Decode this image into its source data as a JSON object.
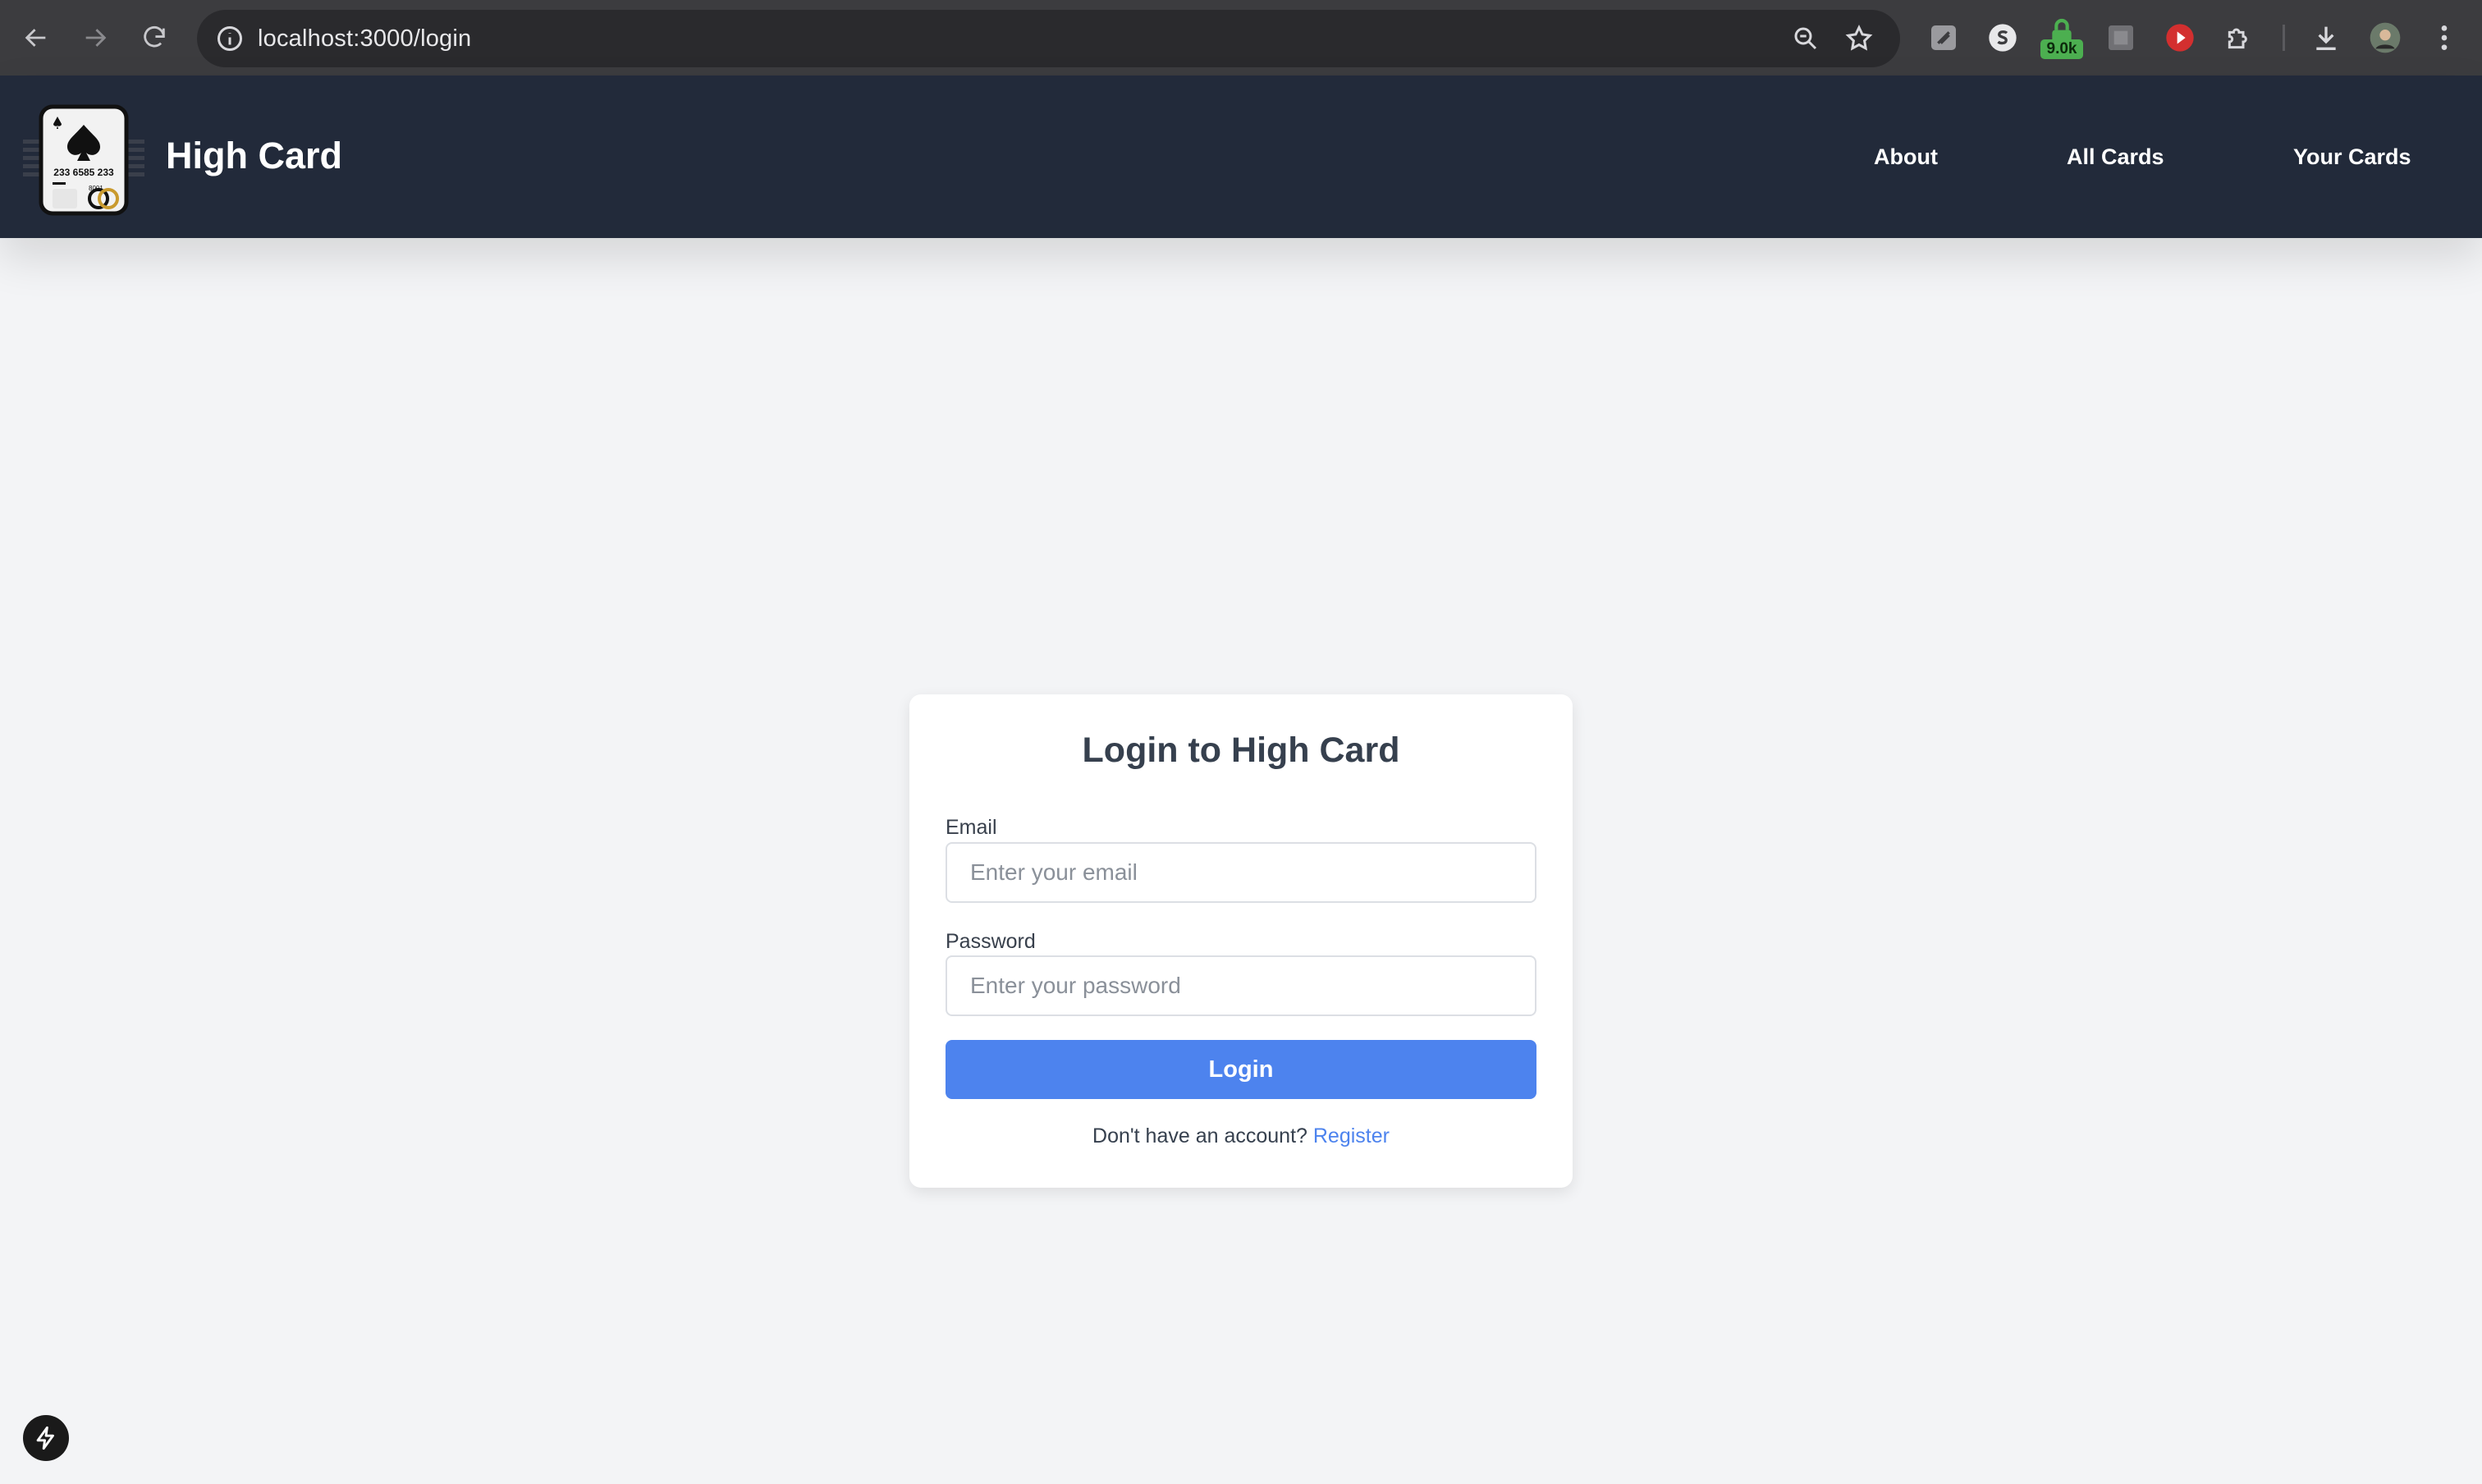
{
  "browser": {
    "url": "localhost:3000/login",
    "extension_badge": "9.0k"
  },
  "header": {
    "brand": "High Card",
    "logo_number": "233 6585 233",
    "nav": [
      {
        "label": "About"
      },
      {
        "label": "All Cards"
      },
      {
        "label": "Your Cards"
      }
    ]
  },
  "login": {
    "title": "Login to High Card",
    "email_label": "Email",
    "email_placeholder": "Enter your email",
    "email_value": "",
    "password_label": "Password",
    "password_placeholder": "Enter your password",
    "password_value": "",
    "button_label": "Login",
    "register_prompt": "Don't have an account?",
    "register_link": "Register"
  },
  "colors": {
    "header_bg": "#222a3a",
    "page_bg": "#f3f4f6",
    "accent": "#4d83ee"
  }
}
